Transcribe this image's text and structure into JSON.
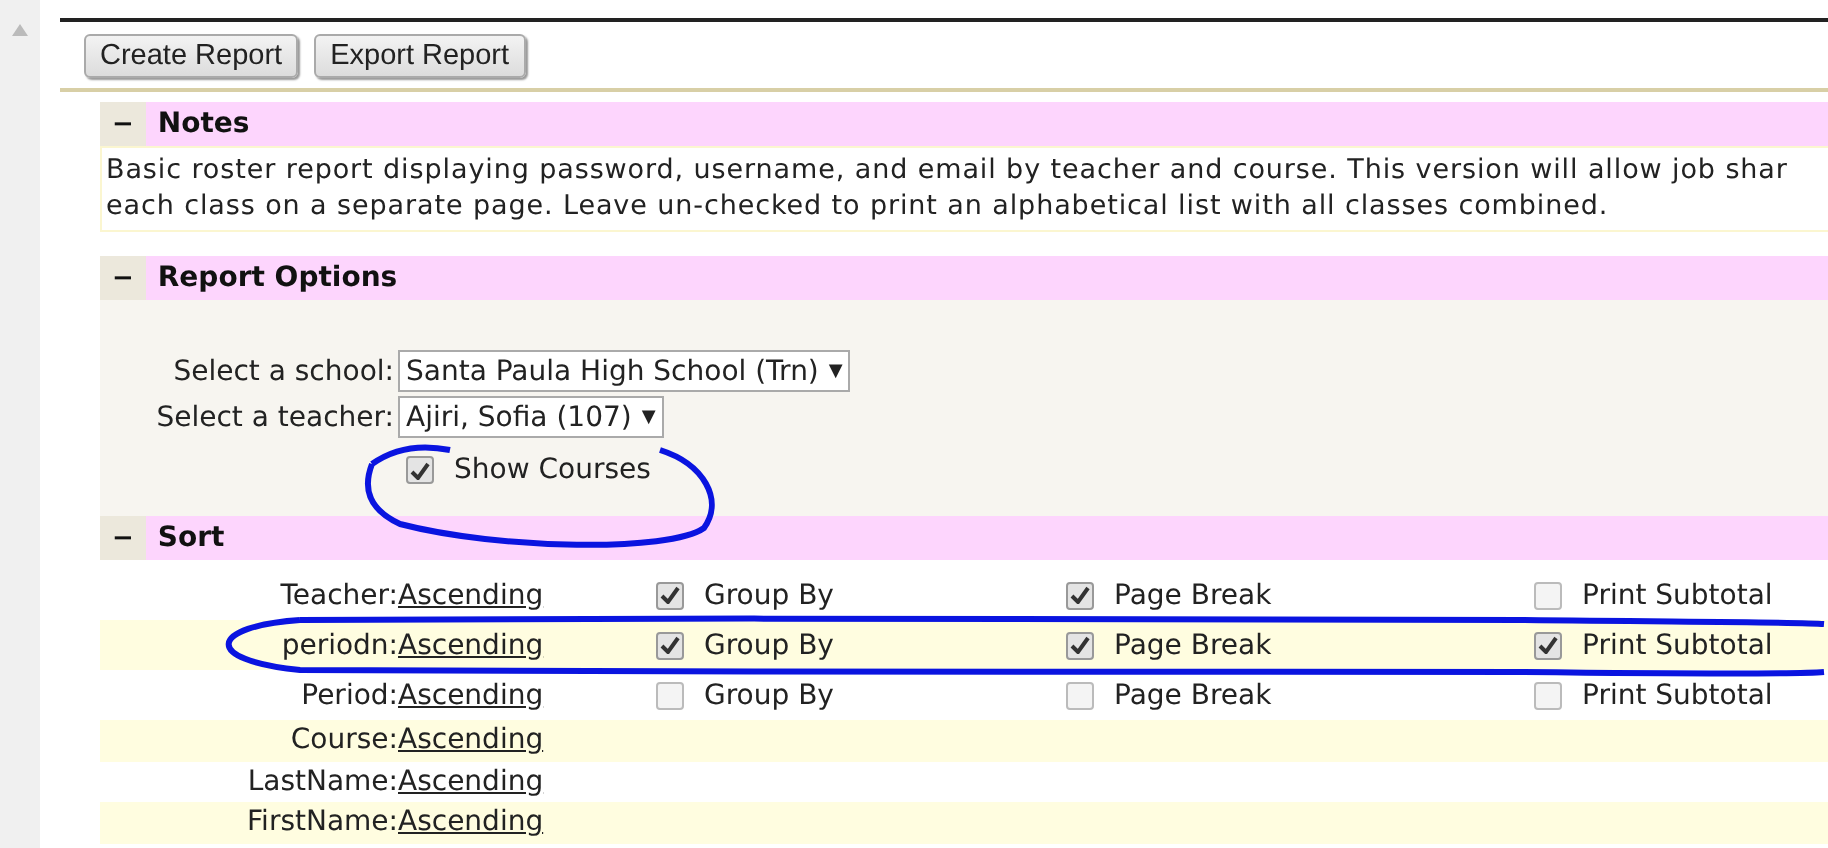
{
  "toolbar": {
    "buttons": [
      "Create Report",
      "Export Report"
    ]
  },
  "notes": {
    "toggle": "−",
    "title": "Notes",
    "lines": [
      "Basic roster report displaying password, username, and email by teacher and course. This version will allow job shar",
      "each class on a separate page. Leave un-checked to print an alphabetical list with all classes combined."
    ]
  },
  "report_options": {
    "toggle": "−",
    "title": "Report Options",
    "fields": [
      {
        "label": "Select a school:",
        "value": "Santa Paula High School (Trn)",
        "caret": "▼"
      },
      {
        "label": "Select a teacher:",
        "value": "Ajiri, Sofia (107)",
        "caret": "▼"
      }
    ],
    "show_courses": {
      "label": "Show Courses",
      "checked": true
    }
  },
  "sort": {
    "toggle": "−",
    "title": "Sort",
    "rows": [
      {
        "field": "Teacher:",
        "order": "Ascending",
        "options": [
          {
            "label": "Group By",
            "checked": true
          },
          {
            "label": "Page Break",
            "checked": true
          },
          {
            "label": "Print Subtotal",
            "checked": false
          }
        ]
      },
      {
        "field": "periodn:",
        "order": "Ascending",
        "options": [
          {
            "label": "Group By",
            "checked": true
          },
          {
            "label": "Page Break",
            "checked": true
          },
          {
            "label": "Print Subtotal",
            "checked": true
          }
        ]
      },
      {
        "field": "Period:",
        "order": "Ascending",
        "options": [
          {
            "label": "Group By",
            "checked": false
          },
          {
            "label": "Page Break",
            "checked": false
          },
          {
            "label": "Print Subtotal",
            "checked": false
          }
        ]
      },
      {
        "field": "Course:",
        "order": "Ascending"
      },
      {
        "field": "LastName:",
        "order": "Ascending"
      },
      {
        "field": "FirstName:",
        "order": "Ascending"
      }
    ]
  }
}
